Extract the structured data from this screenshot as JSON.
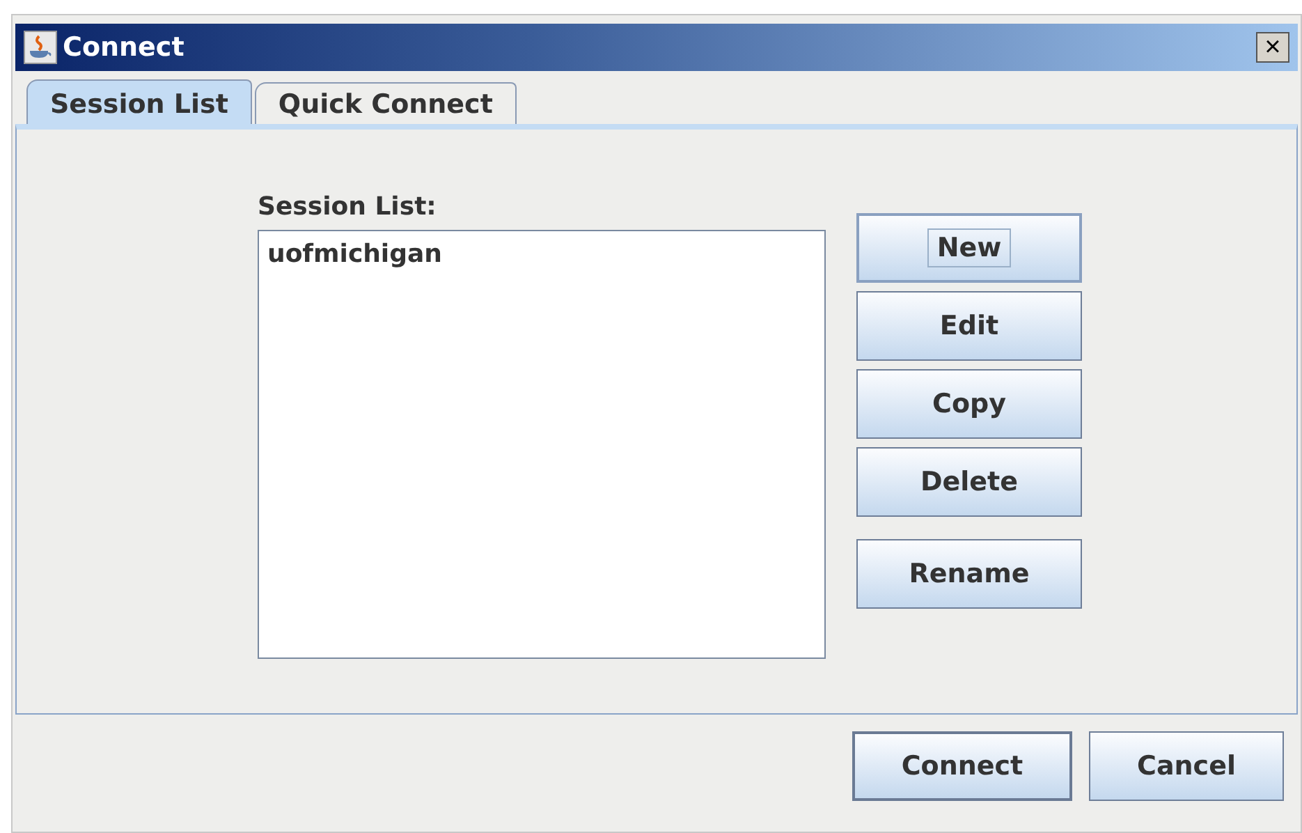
{
  "window": {
    "title": "Connect",
    "close": "×"
  },
  "tabs": [
    {
      "label": "Session List",
      "selected": true
    },
    {
      "label": "Quick Connect",
      "selected": false
    }
  ],
  "session_list": {
    "label": "Session List:",
    "items": [
      {
        "name": "uofmichigan",
        "selected": false
      }
    ]
  },
  "side_buttons": [
    {
      "label": "New",
      "focused": true
    },
    {
      "label": "Edit",
      "focused": false
    },
    {
      "label": "Copy",
      "focused": false
    },
    {
      "label": "Delete",
      "focused": false
    },
    {
      "label": "Rename",
      "focused": false
    }
  ],
  "footer_buttons": [
    {
      "label": "Connect",
      "default": true
    },
    {
      "label": "Cancel",
      "default": false
    }
  ]
}
